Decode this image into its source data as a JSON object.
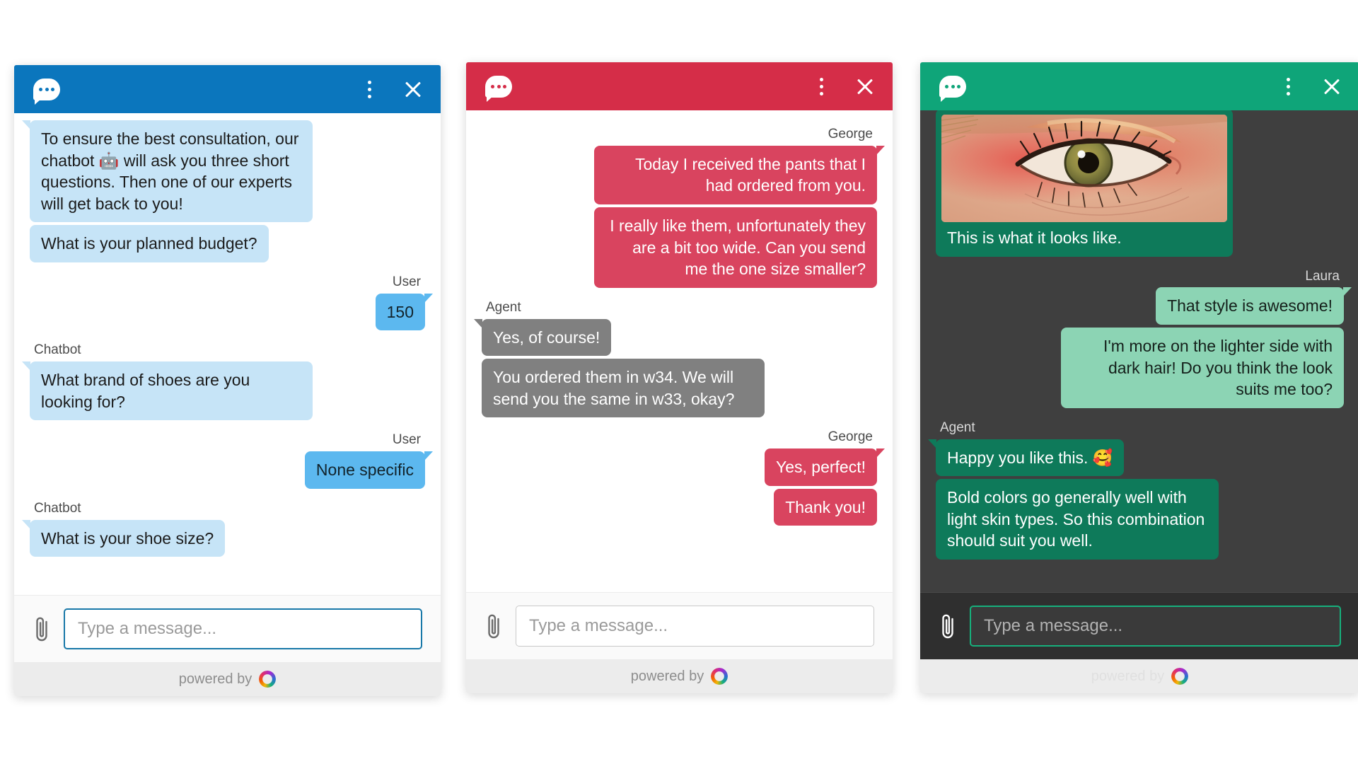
{
  "common": {
    "logo_icon": "chat-bubble-icon",
    "menu_icon": "kebab-menu-icon",
    "close_icon": "close-icon",
    "attach_icon": "paperclip-icon",
    "input_placeholder": "Type a message...",
    "powered_by_label": "powered by",
    "brand_ring_icon": "brand-ring-icon"
  },
  "colors": {
    "blue_header": "#0b76bd",
    "blue_bot_bubble": "#c6e4f7",
    "blue_user_bubble": "#5cb8ef",
    "red_header": "#d52d48",
    "red_user_bubble": "#d9445f",
    "gray_agent_bubble": "#808080",
    "green_header": "#0fa579",
    "green_dark_bg": "#3f3f3f",
    "mint_user_bubble": "#8cd4b4",
    "dark_green_agent_bubble": "#0e7a5a",
    "footer_bg": "#ececec"
  },
  "panels": [
    {
      "id": "chatbot-widget",
      "theme": "blue",
      "messages": [
        {
          "side": "left",
          "kind": "text",
          "tail": true,
          "text": "To ensure the best consultation, our chatbot 🤖 will ask you three short questions. Then one of our experts will get back to you!"
        },
        {
          "side": "left",
          "kind": "text",
          "tail": false,
          "text": "What is your planned budget?"
        },
        {
          "side": "right",
          "kind": "text",
          "tail": true,
          "sender": "User",
          "text": "150"
        },
        {
          "side": "left",
          "kind": "text",
          "tail": true,
          "sender": "Chatbot",
          "text": "What brand of shoes are you looking for?"
        },
        {
          "side": "right",
          "kind": "text",
          "tail": true,
          "sender": "User",
          "text": "None specific"
        },
        {
          "side": "left",
          "kind": "text",
          "tail": true,
          "sender": "Chatbot",
          "text": "What is your shoe size?"
        }
      ]
    },
    {
      "id": "support-widget",
      "theme": "red",
      "messages": [
        {
          "side": "right",
          "kind": "text",
          "tail": true,
          "sender": "George",
          "text": "Today I received the pants that I had ordered from you."
        },
        {
          "side": "right",
          "kind": "text",
          "tail": false,
          "text": "I really like them, unfortunately they are a bit too wide. Can you send me the one size smaller?"
        },
        {
          "side": "left",
          "kind": "text",
          "tail": true,
          "sender": "Agent",
          "text": "Yes, of course!"
        },
        {
          "side": "left",
          "kind": "text",
          "tail": false,
          "text": "You ordered them in w34. We will send you the same in w33, okay?"
        },
        {
          "side": "right",
          "kind": "text",
          "tail": true,
          "sender": "George",
          "text": "Yes, perfect!"
        },
        {
          "side": "right",
          "kind": "text",
          "tail": false,
          "text": "Thank you!"
        }
      ]
    },
    {
      "id": "beauty-widget",
      "theme": "green",
      "messages": [
        {
          "side": "left",
          "kind": "media",
          "tail": false,
          "image_alt": "close-up-eye-makeup-photo",
          "text": "This is what it looks like."
        },
        {
          "side": "right",
          "kind": "text",
          "tail": true,
          "sender": "Laura",
          "text": "That style is awesome!"
        },
        {
          "side": "right",
          "kind": "text",
          "tail": false,
          "text": "I'm more on the lighter side with dark hair! Do you think the look suits me too?"
        },
        {
          "side": "left",
          "kind": "text",
          "tail": true,
          "sender": "Agent",
          "text": "Happy you like this. 🥰"
        },
        {
          "side": "left",
          "kind": "text",
          "tail": false,
          "text": "Bold colors go generally well with light skin types. So this combination should suit you well."
        }
      ]
    }
  ]
}
